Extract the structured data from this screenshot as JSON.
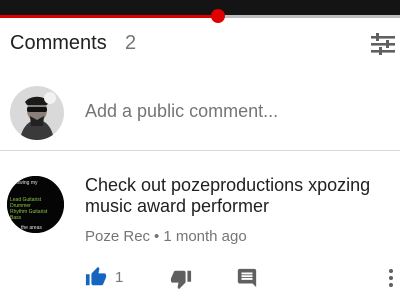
{
  "player": {
    "progress_fraction": 0.545,
    "accent_color": "#e00000"
  },
  "comments_header": {
    "title": "Comments",
    "count": "2",
    "filter_icon": "sort-filter-icon"
  },
  "add_comment": {
    "placeholder": "Add a public comment..."
  },
  "comment": {
    "text": "Check out pozeproductions xpozing music award performer",
    "author": "Poze Rec",
    "separator": "•",
    "time": "1 month ago",
    "like_count": "1",
    "avatar_text": {
      "line1": "following my",
      "line2": "Lead Guitarist",
      "line3": "Drummer",
      "line4": "Rhythm Guitarist",
      "line5": "Bass",
      "line6": "the areas"
    }
  },
  "icons": {
    "like": "thumbs-up-icon",
    "dislike": "thumbs-down-icon",
    "reply": "reply-comment-icon",
    "more": "more-vertical-icon"
  },
  "colors": {
    "like_active": "#1565c0",
    "icon_gray": "#606060",
    "text_primary": "#212121",
    "text_secondary": "#757575"
  }
}
